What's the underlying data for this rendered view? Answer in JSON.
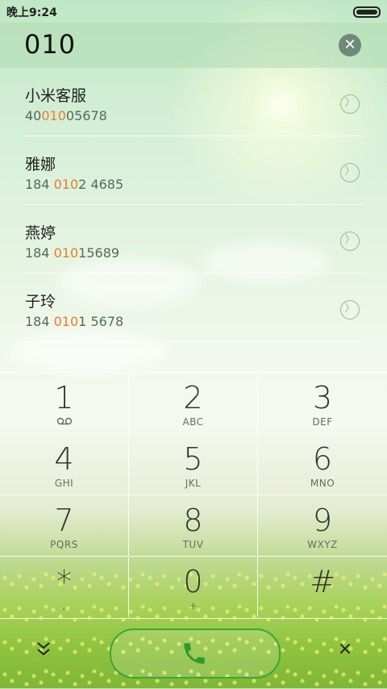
{
  "status_bar": {
    "time": "晚上9:24"
  },
  "input": {
    "number": "010",
    "clear_icon": "x"
  },
  "contacts": [
    {
      "name": "小米客服",
      "phone_pre": "40",
      "phone_match": "010",
      "phone_post": "05678"
    },
    {
      "name": "雅娜",
      "phone_pre": "184 ",
      "phone_match": "010",
      "phone_post": "2 4685"
    },
    {
      "name": "燕婷",
      "phone_pre": "184 ",
      "phone_match": "010",
      "phone_post": "15689"
    },
    {
      "name": "子玲",
      "phone_pre": "184 ",
      "phone_match": "010",
      "phone_post": "1 5678"
    }
  ],
  "dialpad": {
    "keys": [
      {
        "digit": "1",
        "letters": ""
      },
      {
        "digit": "2",
        "letters": "ABC"
      },
      {
        "digit": "3",
        "letters": "DEF"
      },
      {
        "digit": "4",
        "letters": "GHI"
      },
      {
        "digit": "5",
        "letters": "JKL"
      },
      {
        "digit": "6",
        "letters": "MNO"
      },
      {
        "digit": "7",
        "letters": "PQRS"
      },
      {
        "digit": "8",
        "letters": "TUV"
      },
      {
        "digit": "9",
        "letters": "WXYZ"
      },
      {
        "digit": "*",
        "letters": ","
      },
      {
        "digit": "0",
        "letters": "+"
      },
      {
        "digit": "#",
        "letters": ""
      }
    ]
  },
  "bottom_bar": {
    "collapse_icon": "chevron-down-double",
    "delete_icon": "×"
  },
  "colors": {
    "highlight": "#e87c2e",
    "call_green": "#3aa63a"
  }
}
